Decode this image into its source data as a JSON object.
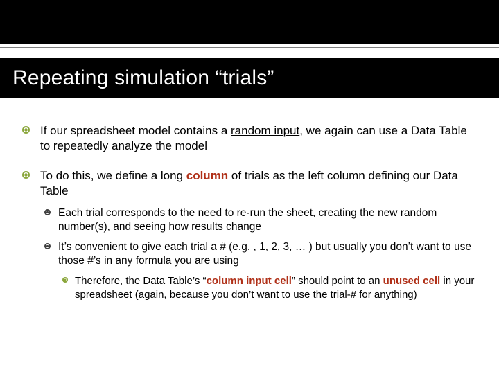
{
  "title": "Repeating simulation “trials”",
  "b1": {
    "pre": "If our spreadsheet model contains a ",
    "u": "random input",
    "post": ", we again can use a Data Table to repeatedly analyze the model"
  },
  "b2": {
    "pre": "To do this, we define a long ",
    "accent": "column",
    "post": " of trials as the left column defining our Data Table"
  },
  "b2s1": "Each trial corresponds to the need to re-run the sheet, creating the new random number(s), and seeing how results change",
  "b2s2": "It’s convenient to give each trial a # (e.g. , 1, 2, 3, … ) but usually you don’t want to use those #’s in any formula you are using",
  "b2s2s1": {
    "pre": "Therefore, the Data Table’s “",
    "accent1": "column input cell",
    "mid": "” should point to an ",
    "accent2": "unused cell",
    "post": " in your spreadsheet (again, because you don’t want to use the trial-# for anything)"
  }
}
